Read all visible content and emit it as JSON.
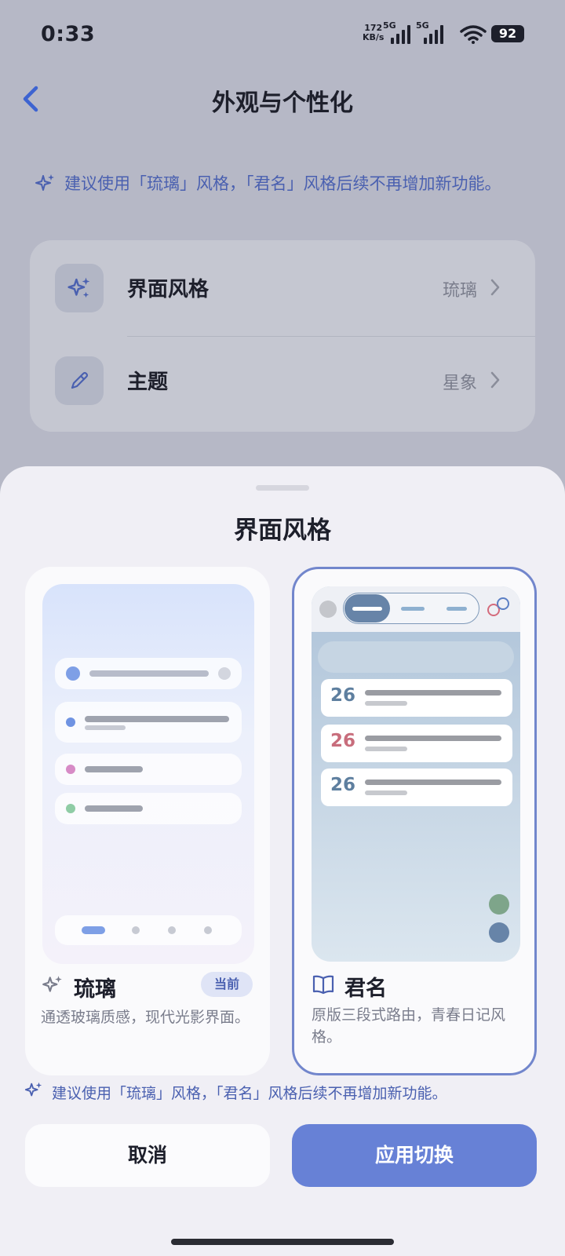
{
  "status_bar": {
    "time": "0:33",
    "net_speed_value": "172",
    "net_speed_unit": "KB/s",
    "sim1": "5G",
    "sim2": "5G",
    "battery": "92"
  },
  "header": {
    "title": "外观与个性化"
  },
  "tip": "建议使用「琉璃」风格，「君名」风格后续不再增加新功能。",
  "settings": [
    {
      "label": "界面风格",
      "value": "琉璃",
      "icon": "sparkle-icon"
    },
    {
      "label": "主题",
      "value": "星象",
      "icon": "pencil-icon"
    }
  ],
  "sheet": {
    "title": "界面风格",
    "options": [
      {
        "name": "琉璃",
        "badge": "当前",
        "desc": "通透玻璃质感，现代光影界面。",
        "icon": "sparkle-icon"
      },
      {
        "name": "君名",
        "desc": "原版三段式路由，青春日记风格。",
        "icon": "book-icon",
        "preview_numbers": [
          "26",
          "26",
          "26"
        ]
      }
    ],
    "tip": "建议使用「琉璃」风格，「君名」风格后续不再增加新功能。",
    "cancel_label": "取消",
    "apply_label": "应用切换"
  },
  "colors": {
    "accent": "#6781d6",
    "tip_text": "#4a60b0",
    "selected_border": "#7286cc"
  }
}
